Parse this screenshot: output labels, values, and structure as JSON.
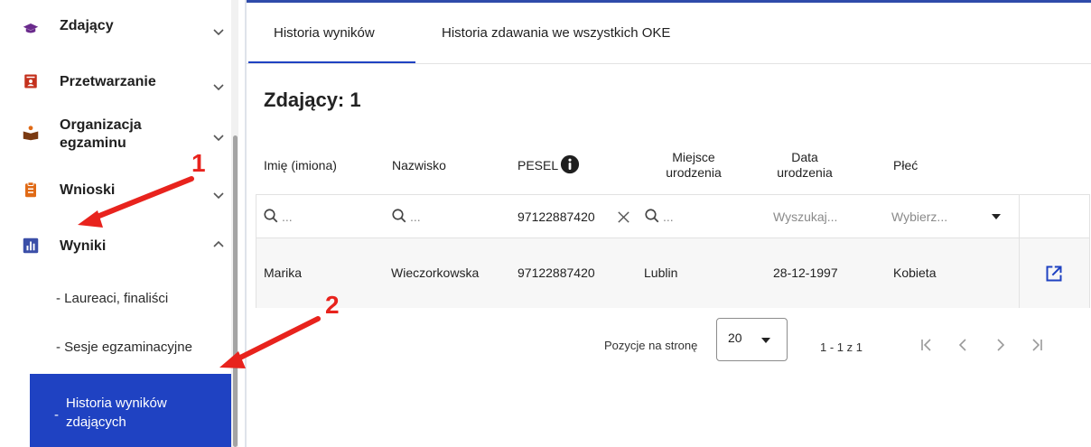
{
  "sidebar": {
    "items": [
      {
        "label": "Zdający",
        "icon": "graduation-cap-icon"
      },
      {
        "label": "Przetwarzanie",
        "icon": "id-card-icon"
      },
      {
        "label": "Organizacja\negzaminu",
        "icon": "person-reading-icon"
      },
      {
        "label": "Wnioski",
        "icon": "clipboard-icon"
      },
      {
        "label": "Wyniki",
        "icon": "bar-chart-icon"
      }
    ],
    "subitems": [
      {
        "label": "- Laureaci, finaliści"
      },
      {
        "label": "- Sesje egzaminacyjne"
      }
    ],
    "active_subitem": {
      "dash": "-",
      "label": "Historia wyników\nzdających"
    }
  },
  "tabs": [
    {
      "label": "Historia wyników",
      "active": true
    },
    {
      "label": "Historia zdawania we wszystkich OKE",
      "active": false
    }
  ],
  "page_title": "Zdający: 1",
  "table": {
    "headers": [
      "Imię (imiona)",
      "Nazwisko",
      "PESEL",
      "Miejsce\nurodzenia",
      "Data\nurodzenia",
      "Płeć"
    ],
    "filters": {
      "first_name_placeholder": "...",
      "last_name_placeholder": "...",
      "pesel_value": "97122887420",
      "birthplace_placeholder": "...",
      "birthdate_placeholder": "Wyszukaj...",
      "gender_placeholder": "Wybierz..."
    },
    "rows": [
      {
        "first_name": "Marika",
        "last_name": "Wieczorkowska",
        "pesel": "97122887420",
        "birthplace": "Lublin",
        "birthdate": "28-12-1997",
        "gender": "Kobieta"
      }
    ]
  },
  "pagination": {
    "per_page_label": "Pozycje na stronę",
    "per_page_value": "20",
    "range_text": "1 - 1 z 1"
  },
  "annotations": {
    "one": "1",
    "two": "2"
  },
  "colors": {
    "accent": "#1f42c2",
    "annotation": "#e8231d",
    "sidebar_icon_orange": "#e06a16",
    "sidebar_icon_red": "#c4311d",
    "sidebar_icon_blue": "#3b4fa8",
    "sidebar_icon_purple": "#6a2a8c"
  }
}
